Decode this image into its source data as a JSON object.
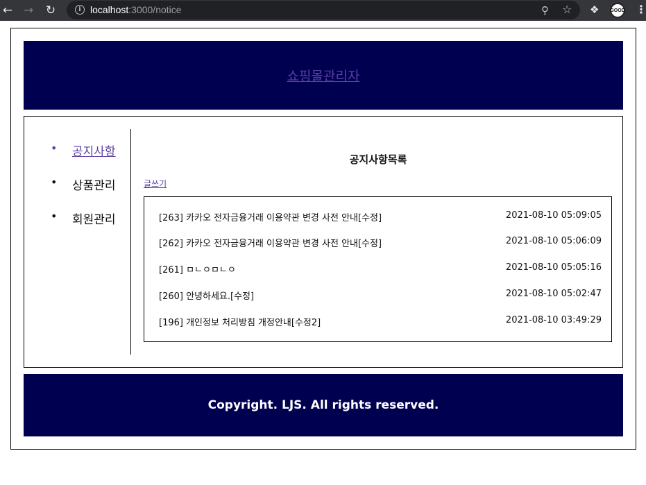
{
  "browser": {
    "url_host": "localhost",
    "url_path": ":3000/notice",
    "avatar_text": "GOOD",
    "icons": [
      "back-icon",
      "forward-icon",
      "reload-icon",
      "info-icon",
      "zoom-icon",
      "star-icon",
      "extensions-icon",
      "menu-icon"
    ]
  },
  "header": {
    "title": "쇼핑몰관리자"
  },
  "sidebar": {
    "items": [
      {
        "label": "공지사항",
        "active": true
      },
      {
        "label": "상품관리",
        "active": false
      },
      {
        "label": "회원관리",
        "active": false
      }
    ]
  },
  "main": {
    "title": "공지사항목록",
    "write_link": "글쓰기",
    "notices": [
      {
        "title": "[263] 카카오 전자금융거래 이용약관 변경 사전 안내[수정]",
        "date": "2021-08-10 05:09:05"
      },
      {
        "title": "[262] 카카오 전자금융거래 이용약관 변경 사전 안내[수정]",
        "date": "2021-08-10 05:06:09"
      },
      {
        "title": "[261] ㅁㄴㅇㅁㄴㅇ",
        "date": "2021-08-10 05:05:16"
      },
      {
        "title": "[260] 안녕하세요.[수정]",
        "date": "2021-08-10 05:02:47"
      },
      {
        "title": "[196] 개인정보 처리방침 개정안내[수정2]",
        "date": "2021-08-10 03:49:29"
      }
    ]
  },
  "footer": {
    "text": "Copyright. LJS. All rights reserved."
  }
}
